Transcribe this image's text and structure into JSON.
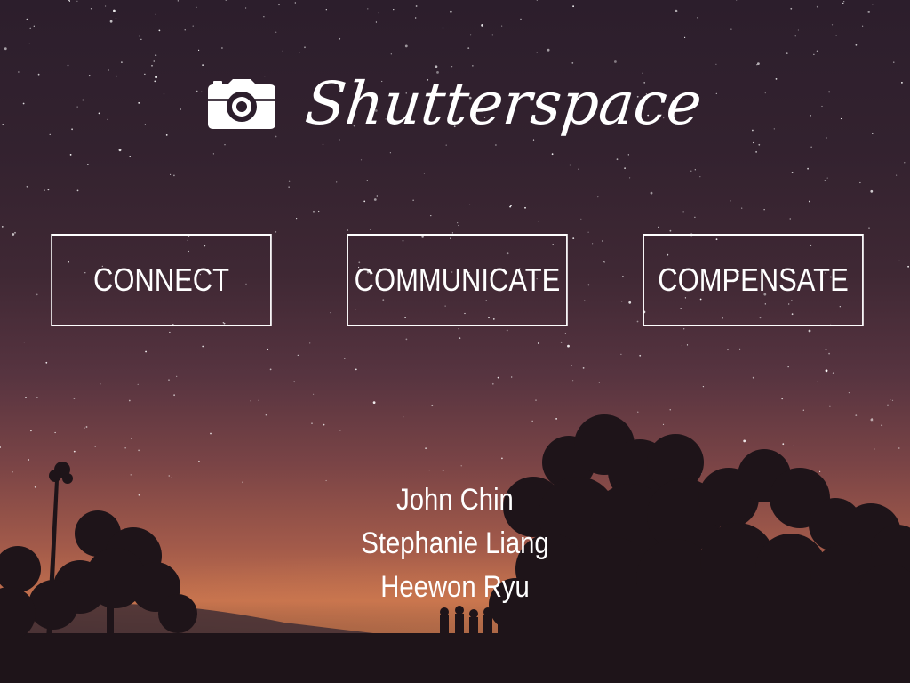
{
  "brand": {
    "name": "Shutterspace",
    "icon": "camera-icon"
  },
  "nav": {
    "buttons": [
      {
        "label": "CONNECT"
      },
      {
        "label": "COMMUNICATE"
      },
      {
        "label": "COMPENSATE"
      }
    ]
  },
  "team": {
    "members": [
      "John Chin",
      "Stephanie Liang",
      "Heewon Ryu"
    ]
  },
  "colors": {
    "text": "#ffffff",
    "sky_top": "#2c1e2c",
    "horizon": "#c4714d",
    "silhouette": "#1e1419"
  }
}
